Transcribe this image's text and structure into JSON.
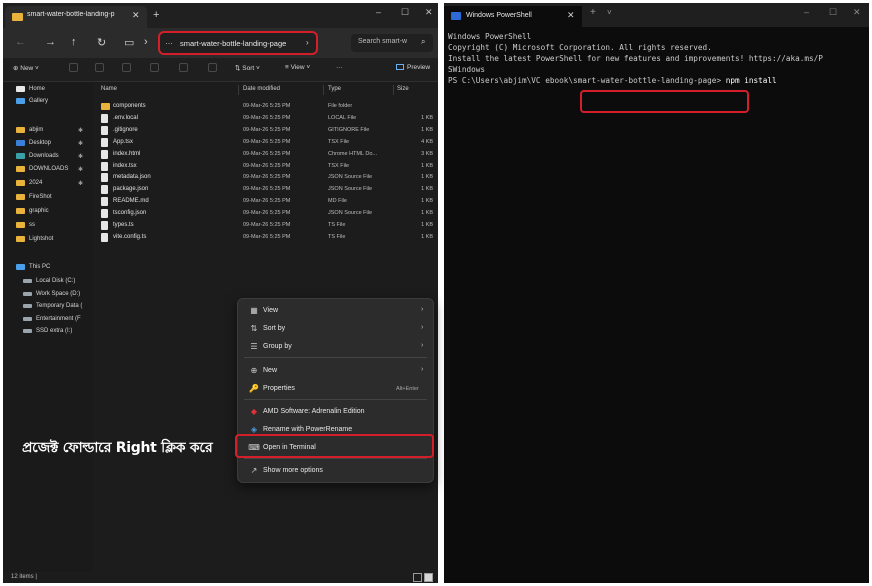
{
  "explorer": {
    "tab_title": "smart-water-bottle-landing-p",
    "tab_close": "✕",
    "new_tab": "+",
    "window_controls": [
      "–",
      "☐",
      "✕"
    ],
    "nav_buttons": [
      "←",
      "→",
      "↑",
      "↻",
      "▭",
      "›"
    ],
    "address": "smart-water-bottle-landing-page",
    "address_chevron": "›",
    "address_more": "…",
    "search_placeholder": "Search smart-w",
    "search_icon": "⌕",
    "toolbar": {
      "new_label": "⊕ New ˅",
      "sort_label": "⇅ Sort ˅",
      "view_label": "≡ View ˅",
      "more_label": "···",
      "preview_label": "Preview"
    },
    "nav": [
      {
        "label": "Home",
        "color": "#e8e8e8"
      },
      {
        "label": "Gallery",
        "color": "#4aa0e8"
      },
      {
        "label": "abjim",
        "color": "#e8b23c",
        "pinned": true
      },
      {
        "label": "Desktop",
        "color": "#3a7fd8",
        "pinned": true
      },
      {
        "label": "Downloads",
        "color": "#3aa0a8",
        "pinned": true
      },
      {
        "label": "DOWNLOADS",
        "color": "#e8b23c",
        "pinned": true
      },
      {
        "label": "2024",
        "color": "#e8b23c",
        "pinned": true
      },
      {
        "label": "FireShot",
        "color": "#e8b23c"
      },
      {
        "label": "graphic",
        "color": "#e8b23c"
      },
      {
        "label": "ss",
        "color": "#e8b23c"
      },
      {
        "label": "Lightshot",
        "color": "#e8b23c"
      }
    ],
    "pin_icon": "✱",
    "this_pc": "This PC",
    "drives": [
      "Local Disk (C:)",
      "Work Space (D:)",
      "Temporary Data (",
      "Entertainment (F",
      "SSD extra (I:)"
    ],
    "columns": {
      "name": "Name",
      "date": "Date modified",
      "type": "Type",
      "size": "Size"
    },
    "files": [
      {
        "name": "components",
        "date": "09-Mar-26 5:25 PM",
        "type": "File folder",
        "size": "",
        "folder": true
      },
      {
        "name": ".env.local",
        "date": "09-Mar-26 5:25 PM",
        "type": "LOCAL File",
        "size": "1 KB"
      },
      {
        "name": ".gitignore",
        "date": "09-Mar-26 5:25 PM",
        "type": "GITIGNORE File",
        "size": "1 KB"
      },
      {
        "name": "App.tsx",
        "date": "09-Mar-26 5:25 PM",
        "type": "TSX File",
        "size": "4 KB"
      },
      {
        "name": "index.html",
        "date": "09-Mar-26 5:25 PM",
        "type": "Chrome HTML Do...",
        "size": "3 KB"
      },
      {
        "name": "index.tsx",
        "date": "09-Mar-26 5:25 PM",
        "type": "TSX File",
        "size": "1 KB"
      },
      {
        "name": "metadata.json",
        "date": "09-Mar-26 5:25 PM",
        "type": "JSON Source File",
        "size": "1 KB"
      },
      {
        "name": "package.json",
        "date": "09-Mar-26 5:25 PM",
        "type": "JSON Source File",
        "size": "1 KB"
      },
      {
        "name": "README.md",
        "date": "09-Mar-26 5:25 PM",
        "type": "MD File",
        "size": "1 KB"
      },
      {
        "name": "tsconfig.json",
        "date": "09-Mar-26 5:25 PM",
        "type": "JSON Source File",
        "size": "1 KB"
      },
      {
        "name": "types.ts",
        "date": "09-Mar-26 5:25 PM",
        "type": "TS File",
        "size": "1 KB"
      },
      {
        "name": "vite.config.ts",
        "date": "09-Mar-26 5:25 PM",
        "type": "TS File",
        "size": "1 KB"
      }
    ],
    "status": "12 items |",
    "context_menu": [
      {
        "icon": "▦",
        "label": "View",
        "arrow": "›"
      },
      {
        "icon": "⇅",
        "label": "Sort by",
        "arrow": "›"
      },
      {
        "icon": "☰",
        "label": "Group by",
        "arrow": "›"
      },
      {
        "sep": true
      },
      {
        "icon": "⊕",
        "label": "New",
        "arrow": "›"
      },
      {
        "icon": "🔑",
        "label": "Properties",
        "shortcut": "Alt+Enter"
      },
      {
        "sep": true
      },
      {
        "icon": "◆",
        "label": "AMD Software: Adrenalin Edition",
        "icon_color": "#e0303a"
      },
      {
        "icon": "◈",
        "label": "Rename with PowerRename",
        "icon_color": "#4aa0e8"
      },
      {
        "icon": "⌨",
        "label": "Open in Terminal"
      },
      {
        "sep": true
      },
      {
        "icon": "↗",
        "label": "Show more options"
      }
    ],
    "annotation": "প্রজেক্ট ফোল্ডারে Right ক্লিক করে"
  },
  "powershell": {
    "tab_title": "Windows PowerShell",
    "tab_close": "✕",
    "new_tab": "+",
    "dropdown": "˅",
    "window_controls": [
      "–",
      "☐",
      "✕"
    ],
    "lines": [
      "Windows PowerShell",
      "Copyright (C) Microsoft Corporation. All rights reserved.",
      "",
      "Install the latest PowerShell for new features and improvements! https://aka.ms/P",
      "SWindows",
      ""
    ],
    "prompt": "PS C:\\Users\\abjim\\VC ebook\\smart-water-bottle-landing-page>",
    "command": " npm install"
  }
}
